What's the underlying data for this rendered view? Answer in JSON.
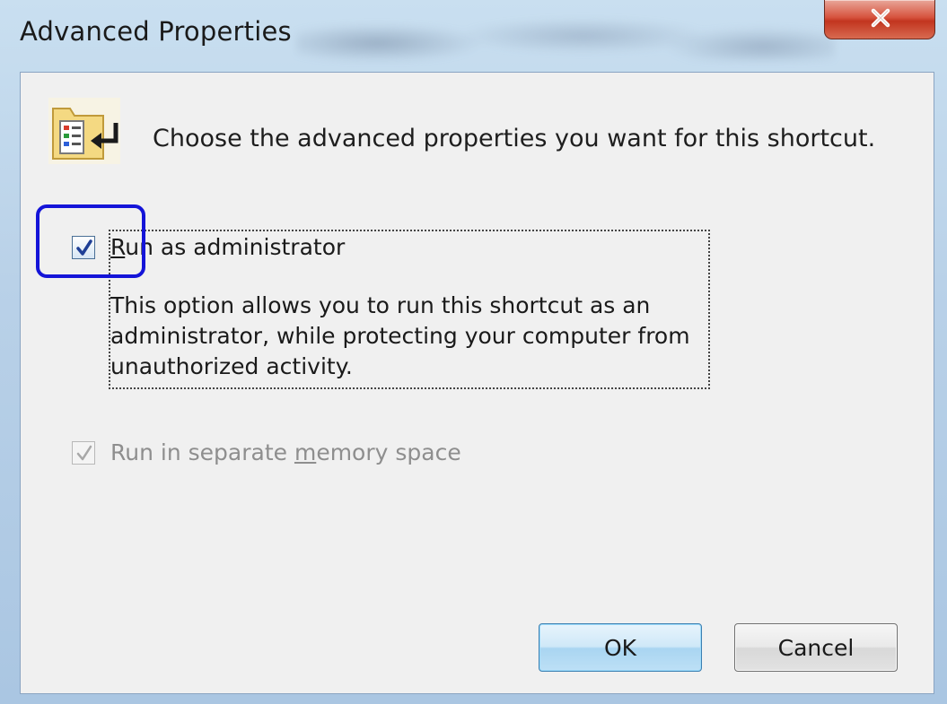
{
  "window": {
    "title": "Advanced Properties"
  },
  "header": {
    "text": "Choose the advanced properties you want for this shortcut."
  },
  "options": {
    "run_as_admin": {
      "label_mnemonic": "R",
      "label_pre": "u",
      "label_rest": "n as administrator",
      "checked": true,
      "description": "This option allows you to run this shortcut as an administrator, while protecting your computer from unauthorized activity."
    },
    "separate_memory": {
      "label_pre": "Run in separate ",
      "label_mnemonic": "m",
      "label_rest": "emory space",
      "checked": true,
      "enabled": false
    }
  },
  "buttons": {
    "ok": "OK",
    "cancel": "Cancel"
  },
  "colors": {
    "highlight": "#1414d8",
    "client_bg": "#f0f0f0",
    "close_red": "#c2351f"
  },
  "icons": {
    "header": "shortcut-properties-icon",
    "close": "close-icon",
    "check": "checkmark-icon"
  }
}
